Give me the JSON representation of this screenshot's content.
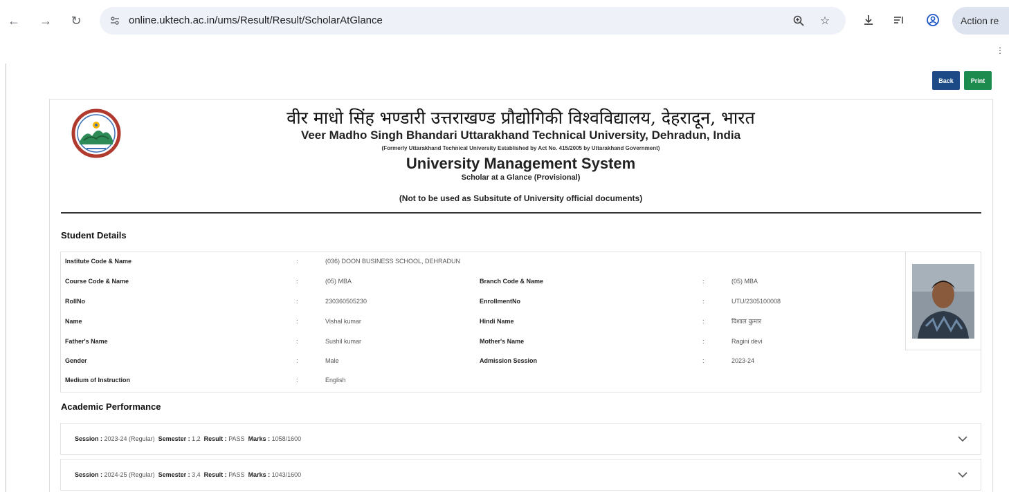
{
  "browser": {
    "url": "online.uktech.ac.in/ums/Result/Result/ScholarAtGlance",
    "action_chip": "Action re"
  },
  "buttons": {
    "back": "Back",
    "print": "Print"
  },
  "header": {
    "hindi_title": "वीर माधो सिंह भण्डारी उत्तराखण्ड प्रौद्योगिकी विश्वविद्यालय, देहरादून, भारत",
    "english_title": "Veer Madho Singh Bhandari Uttarakhand Technical University, Dehradun, India",
    "formerly": "(Formerly Uttarakhand Technical University Established by Act No. 415/2005 by Uttarakhand Government)",
    "system": "University Management System",
    "subtitle": "Scholar at a Glance (Provisional)",
    "disclaimer": "(Not to be used as Subsitute of University official documents)"
  },
  "student": {
    "section_title": "Student Details",
    "institute_label": "Institute Code & Name",
    "institute_value": "(036) DOON BUSINESS SCHOOL, DEHRADUN",
    "course_label": "Course Code & Name",
    "course_value": "(05) MBA",
    "branch_label": "Branch Code & Name",
    "branch_value": "(05) MBA",
    "rollno_label": "RollNo",
    "rollno_value": "230360505230",
    "enrollment_label": "EnrollmentNo",
    "enrollment_value": "UTU/2305100008",
    "name_label": "Name",
    "name_value": "Vishal kumar",
    "hindi_name_label": "Hindi Name",
    "hindi_name_value": "विशाल कुमार",
    "father_label": "Father's Name",
    "father_value": "Sushil kumar",
    "mother_label": "Mother's Name",
    "mother_value": "Ragini devi",
    "gender_label": "Gender",
    "gender_value": "Male",
    "admission_label": "Admission Session",
    "admission_value": "2023-24",
    "medium_label": "Medium of Instruction",
    "medium_value": "English",
    "colon": ":"
  },
  "performance": {
    "section_title": "Academic Performance",
    "labels": {
      "session": "Session :",
      "semester": "Semester :",
      "result": "Result :",
      "marks": "Marks :"
    },
    "rows": [
      {
        "session": "2023-24 (Regular)",
        "semester": "1,2",
        "result": "PASS",
        "marks": "1058/1600"
      },
      {
        "session": "2024-25 (Regular)",
        "semester": "3,4",
        "result": "PASS",
        "marks": "1043/1600"
      }
    ]
  }
}
